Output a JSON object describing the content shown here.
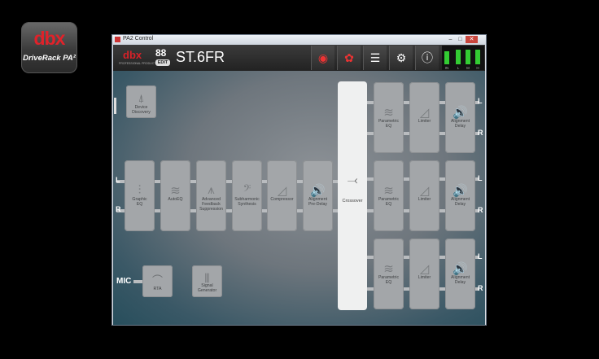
{
  "app_icon": {
    "logo": "dbx",
    "subtitle": "DriveRack PA²"
  },
  "window": {
    "title": "PA2 Control",
    "controls": [
      "–",
      "□",
      "✕"
    ]
  },
  "topbar": {
    "brand": "dbx",
    "brand_tag": "PROFESSIONAL PRODUCTS",
    "preset_number": "88",
    "edit_badge": "EDIT",
    "preset_name": "ST.6FR",
    "buttons": [
      {
        "icon": "rta-icon",
        "glyph": "◉"
      },
      {
        "icon": "wizard-icon",
        "glyph": "✿"
      },
      {
        "icon": "list-icon",
        "glyph": "☰"
      },
      {
        "icon": "gear-icon",
        "glyph": "⚙"
      },
      {
        "icon": "info-icon",
        "glyph": "ⓘ"
      }
    ],
    "meters": [
      {
        "label": "IN",
        "level": 0.7
      },
      {
        "label": "L",
        "level": 0.75
      },
      {
        "label": "M",
        "level": 0.75
      },
      {
        "label": "H",
        "level": 0.75
      }
    ]
  },
  "device_discovery": "Device\nDiscovery",
  "input_labels": {
    "left": "L",
    "right": "R",
    "mic": "MIC"
  },
  "chain": [
    {
      "name": "graphic-eq",
      "label": "Graphic\nEQ",
      "glyph": "⫶"
    },
    {
      "name": "autoeq",
      "label": "AutoEQ",
      "glyph": "≋"
    },
    {
      "name": "afs",
      "label": "Advanced\nFeedback\nSuppression",
      "glyph": "⩚"
    },
    {
      "name": "subharmonic",
      "label": "Subharmonic\nSynthesis",
      "glyph": "𝄢"
    },
    {
      "name": "compressor",
      "label": "Compressor",
      "glyph": "◿"
    },
    {
      "name": "alignment-predelay",
      "label": "Alignment\nPre-Delay",
      "glyph": "🔊"
    }
  ],
  "crossover": {
    "label": "Crossover",
    "glyph": "⤙"
  },
  "outputs": [
    {
      "peq": "Parametric\nEQ",
      "limiter": "Limiter",
      "delay": "Alignment\nDelay",
      "left": "L",
      "right": "R"
    },
    {
      "peq": "Parametric\nEQ",
      "limiter": "Limiter",
      "delay": "Alignment\nDelay",
      "left": "L",
      "right": "R"
    },
    {
      "peq": "Parametric\nEQ",
      "limiter": "Limiter",
      "delay": "Alignment\nDelay",
      "left": "L",
      "right": "R"
    }
  ],
  "rta": "RTA",
  "signal_generator": "Signal\nGenerator"
}
